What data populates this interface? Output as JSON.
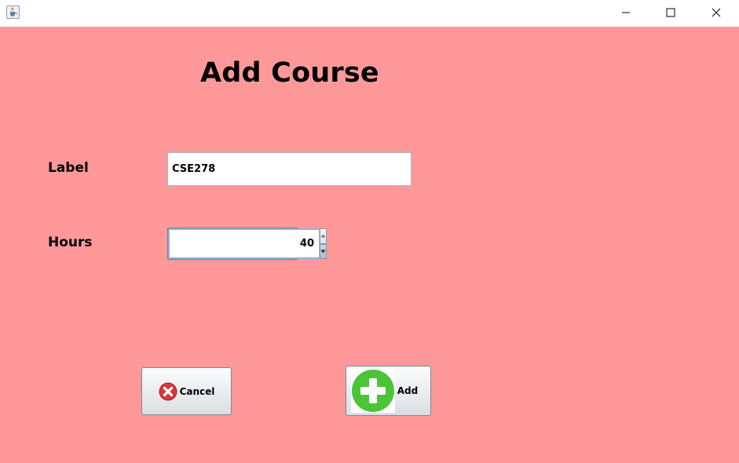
{
  "window": {
    "title_icon": "java-cup-icon",
    "background": "#ff9999",
    "controls": {
      "minimize_icon": "minimize-icon",
      "maximize_icon": "maximize-icon",
      "close_icon": "close-icon"
    }
  },
  "form": {
    "heading": "Add Course",
    "label_field": {
      "label": "Label",
      "value": "CSE278"
    },
    "hours_field": {
      "label": "Hours",
      "value": "40"
    }
  },
  "buttons": {
    "cancel": {
      "label": "Cancel",
      "icon": "cancel-x-icon",
      "icon_color": "#d9363e"
    },
    "add": {
      "label": "Add",
      "icon": "plus-icon",
      "icon_color": "#4cc43a"
    }
  }
}
